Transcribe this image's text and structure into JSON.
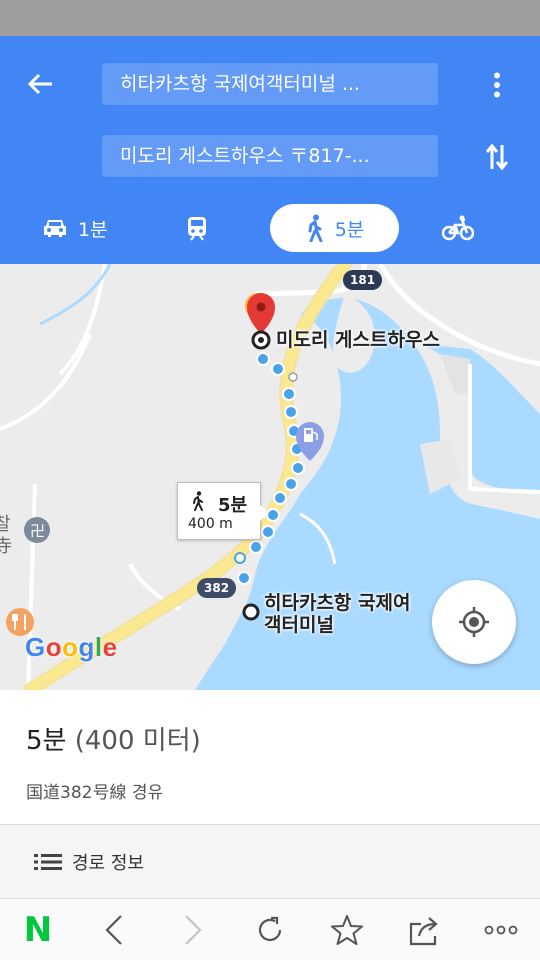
{
  "header": {
    "origin_value": "히타카츠항 국제여객터미널 ...",
    "destination_value": "미도리 게스트하우스 〒817-...",
    "modes": [
      {
        "name": "drive",
        "label": "1분",
        "icon": "car-icon"
      },
      {
        "name": "transit",
        "label": "",
        "icon": "train-icon"
      },
      {
        "name": "walk",
        "label": "5분",
        "icon": "walk-icon",
        "selected": true
      },
      {
        "name": "bike",
        "label": "",
        "icon": "bike-icon"
      }
    ],
    "accent_color": "#4285f4"
  },
  "map": {
    "destination_label": "미도리 게스트하우스",
    "origin_label": "히타카츠항 국제여객터미널",
    "route_time": "5분",
    "route_distance": "400 m",
    "road_181": "181",
    "road_382": "382",
    "partial_poi_text": "찰\n寺",
    "google_logo": [
      "G",
      "o",
      "o",
      "g",
      "l",
      "e"
    ]
  },
  "summary": {
    "duration": "5분",
    "distance": "(400 미터)",
    "via": "国道382号線 경유"
  },
  "details": {
    "label": "경로 정보"
  },
  "browser_bar": {
    "buttons": [
      "naver-logo",
      "back-icon",
      "forward-icon",
      "reload-icon",
      "bookmark-star-icon",
      "share-icon",
      "more-icon"
    ],
    "naver_letter": "N"
  }
}
